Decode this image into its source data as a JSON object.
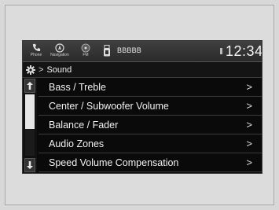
{
  "topbar": {
    "phone_label": "Phone",
    "nav_label": "Navigation",
    "fm_label": "FM",
    "source_name": "BBBBB",
    "clock": "12:34"
  },
  "breadcrumb": {
    "separator": ">",
    "title": "Sound"
  },
  "menu": {
    "arrow": ">",
    "items": [
      {
        "label": "Bass / Treble"
      },
      {
        "label": "Center / Subwoofer Volume"
      },
      {
        "label": "Balance / Fader"
      },
      {
        "label": "Audio Zones"
      },
      {
        "label": "Speed Volume Compensation"
      }
    ]
  },
  "scrollbar": {
    "position_fraction": 0.0
  },
  "icons": {
    "phone": "phone-icon",
    "navigation": "navigation-icon",
    "fm": "fm-icon",
    "usb": "usb-icon",
    "settings": "gear-icon",
    "scroll_up": "scroll-up-icon",
    "scroll_down": "scroll-down-icon"
  },
  "colors": {
    "screen_bg": "#0a0a0a",
    "text": "#f2f2f2",
    "divider": "#3a3a3a",
    "scroll_thumb": "#e6e6e6"
  }
}
